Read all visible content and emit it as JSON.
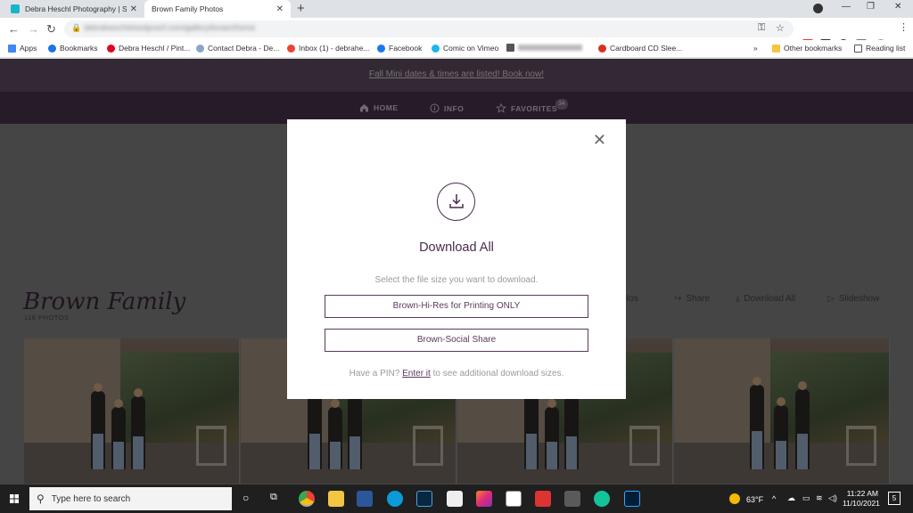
{
  "browser": {
    "tabs": [
      {
        "title": "Debra Heschl Photography | Sho",
        "active": false
      },
      {
        "title": "Brown Family Photos",
        "active": true
      }
    ],
    "new_tab": "+",
    "window_controls": {
      "minimize": "—",
      "restore": "❐",
      "close": "✕"
    },
    "bookmarks": [
      {
        "label": "Apps",
        "icon": "apps-grid-icon",
        "color": "#4285f4"
      },
      {
        "label": "Bookmarks",
        "icon": "star-icon",
        "color": "#1a73e8"
      },
      {
        "label": "Debra Heschl / Pint...",
        "icon": "pinterest-icon",
        "color": "#e60023"
      },
      {
        "label": "Contact Debra - De...",
        "icon": "site-icon",
        "color": "#8aa6c8"
      },
      {
        "label": "Inbox (1) - debrahe...",
        "icon": "gmail-icon",
        "color": "#ea4335"
      },
      {
        "label": "Facebook",
        "icon": "facebook-icon",
        "color": "#1877f2"
      },
      {
        "label": "Comic on Vimeo",
        "icon": "vimeo-icon",
        "color": "#1ab7ea"
      },
      {
        "label": "Cardboard CD Slee...",
        "icon": "site-icon",
        "color": "#d93025"
      }
    ],
    "bookmarks_more": "»",
    "other_bookmarks": "Other bookmarks",
    "reading_list": "Reading list"
  },
  "site": {
    "banner": "Fall Mini dates & times are listed! Book now!",
    "nav": {
      "home": "HOME",
      "info": "INFO",
      "favorites": "FAVORITES",
      "favorites_count": "34"
    },
    "gallery_title": "Brown Family",
    "photo_count": "116 PHOTOS",
    "actions": {
      "photos_partial": "otos",
      "share": "Share",
      "download_all": "Download All",
      "slideshow": "Slideshow"
    }
  },
  "modal": {
    "title": "Download All",
    "subtitle": "Select the file size you want to download.",
    "options": [
      "Brown-Hi-Res for Printing ONLY",
      "Brown-Social Share"
    ],
    "pin_prefix": "Have a PIN?",
    "pin_link": "Enter it",
    "pin_suffix": "to see additional download sizes.",
    "close": "✕"
  },
  "taskbar": {
    "search_placeholder": "Type here to search",
    "weather": "63°F",
    "time": "11:22 AM",
    "date": "11/10/2021",
    "notifications": "5",
    "colors": {
      "accent": "#4a2a4c",
      "taskbar": "#1f1f1f"
    }
  }
}
